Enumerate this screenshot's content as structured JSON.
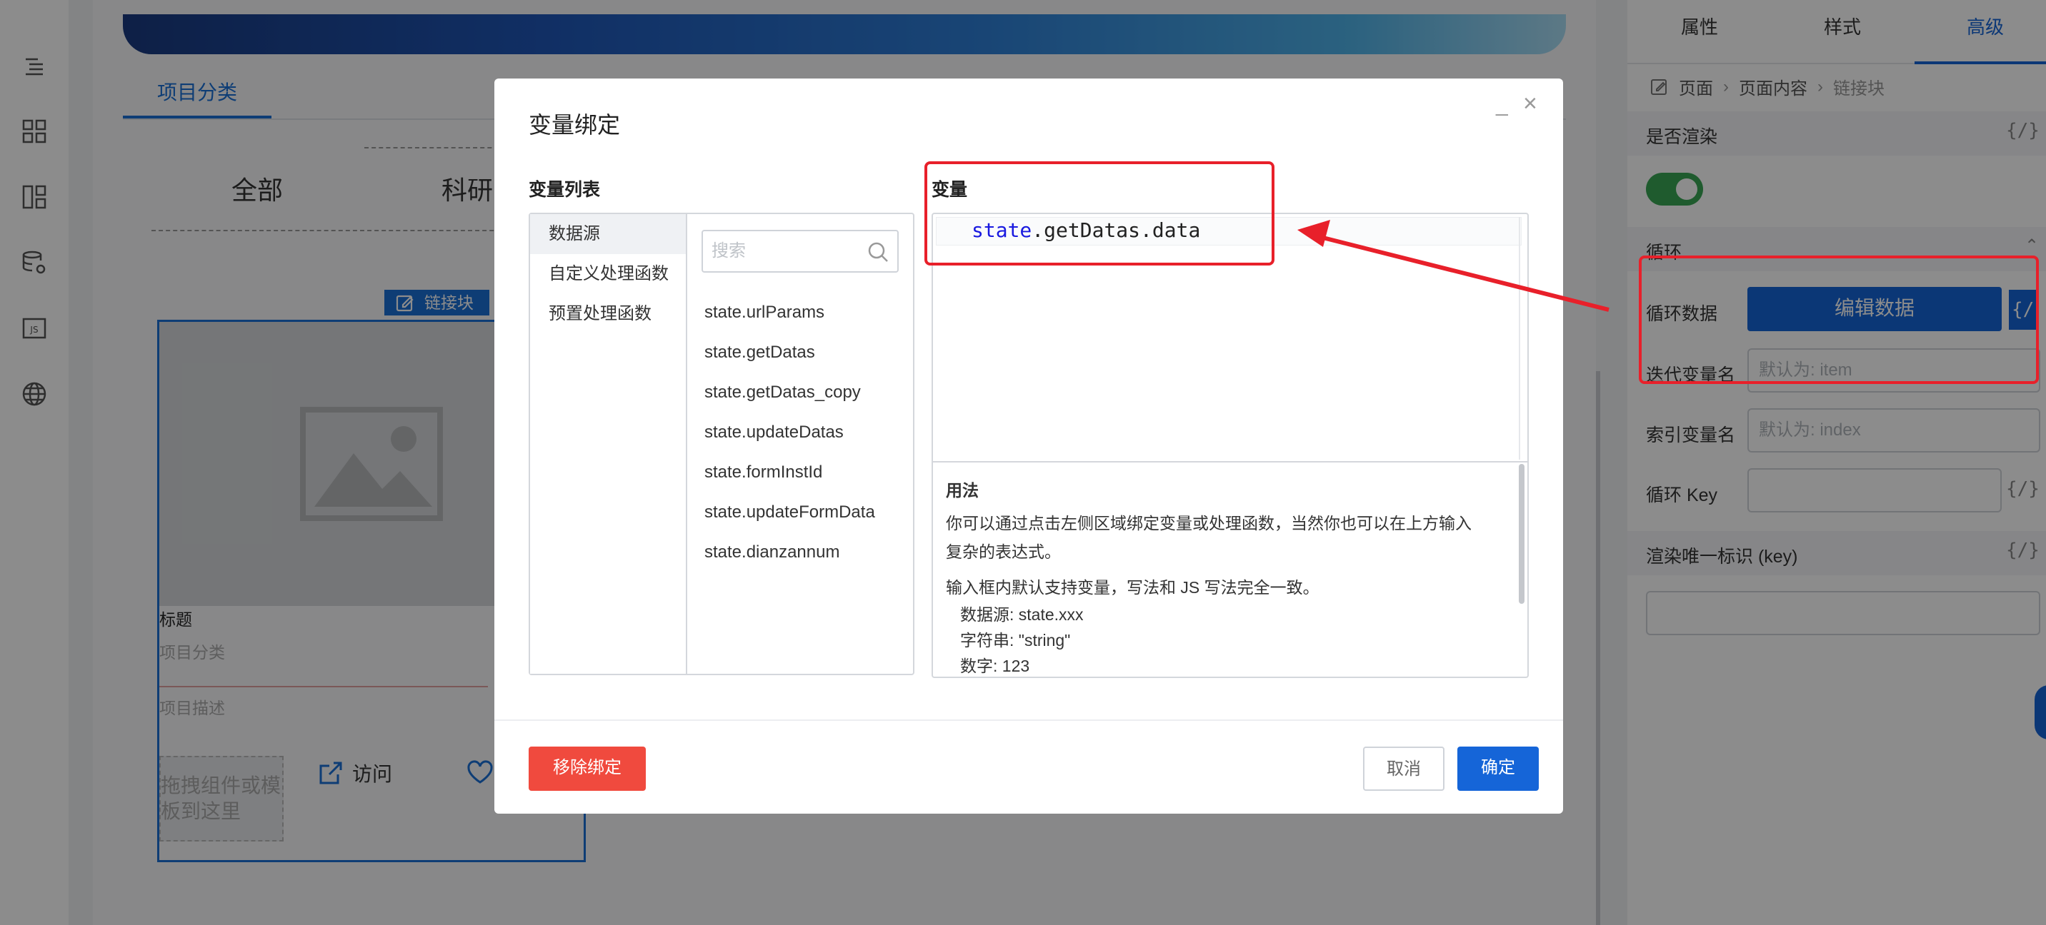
{
  "background": {
    "sidebar_icons": [
      "outline-icon",
      "grid-icon",
      "layout-icon",
      "database-settings-icon",
      "js-icon",
      "globe-icon"
    ],
    "canvas": {
      "tab": "项目分类",
      "filters": [
        "全部",
        "科研"
      ],
      "link_block_tag": "链接块",
      "card": {
        "title_label": "标题",
        "category_placeholder": "项目分类",
        "desc_placeholder": "项目描述",
        "drop_hint": "拖拽组件或模板到这里",
        "visit_label": "访问"
      }
    }
  },
  "right_panel": {
    "tabs": [
      "属性",
      "样式",
      "高级"
    ],
    "active_tab": "高级",
    "breadcrumb": [
      "页面",
      "页面内容",
      "链接块"
    ],
    "render_label": "是否渲染",
    "render_on": true,
    "loop_section": "循环",
    "loop_data_label": "循环数据",
    "edit_data_button": "编辑数据",
    "iter_var_label": "迭代变量名",
    "iter_var_placeholder": "默认为: item",
    "index_var_label": "索引变量名",
    "index_var_placeholder": "默认为: index",
    "loop_key_label": "循环 Key",
    "unique_key_label": "渲染唯一标识 (key)",
    "code_toggle": "{/}"
  },
  "modal": {
    "title": "变量绑定",
    "var_list_label": "变量列表",
    "categories": [
      "数据源",
      "自定义处理函数",
      "预置处理函数"
    ],
    "search_placeholder": "搜索",
    "variables": [
      "state.urlParams",
      "state.getDatas",
      "state.getDatas_copy",
      "state.updateDatas",
      "state.formInstId",
      "state.updateFormData",
      "state.dianzannum"
    ],
    "variable_label": "变量",
    "expression_keyword": "state",
    "expression_rest": ".getDatas.data",
    "usage": {
      "title": "用法",
      "line1": "你可以通过点击左侧区域绑定变量或处理函数，当然你也可以在上方输入",
      "line2": "复杂的表达式。",
      "line3": "输入框内默认支持变量，写法和 JS 写法完全一致。",
      "line4": "数据源: state.xxx",
      "line5": "字符串: \"string\"",
      "line6": "数字: 123"
    },
    "remove_button": "移除绑定",
    "cancel_button": "取消",
    "confirm_button": "确定",
    "minimize": "_",
    "close": "×"
  },
  "colors": {
    "primary": "#1565d8",
    "danger": "#f04a3e",
    "annotation": "#e8202a",
    "toggle_on": "#3aa655"
  }
}
